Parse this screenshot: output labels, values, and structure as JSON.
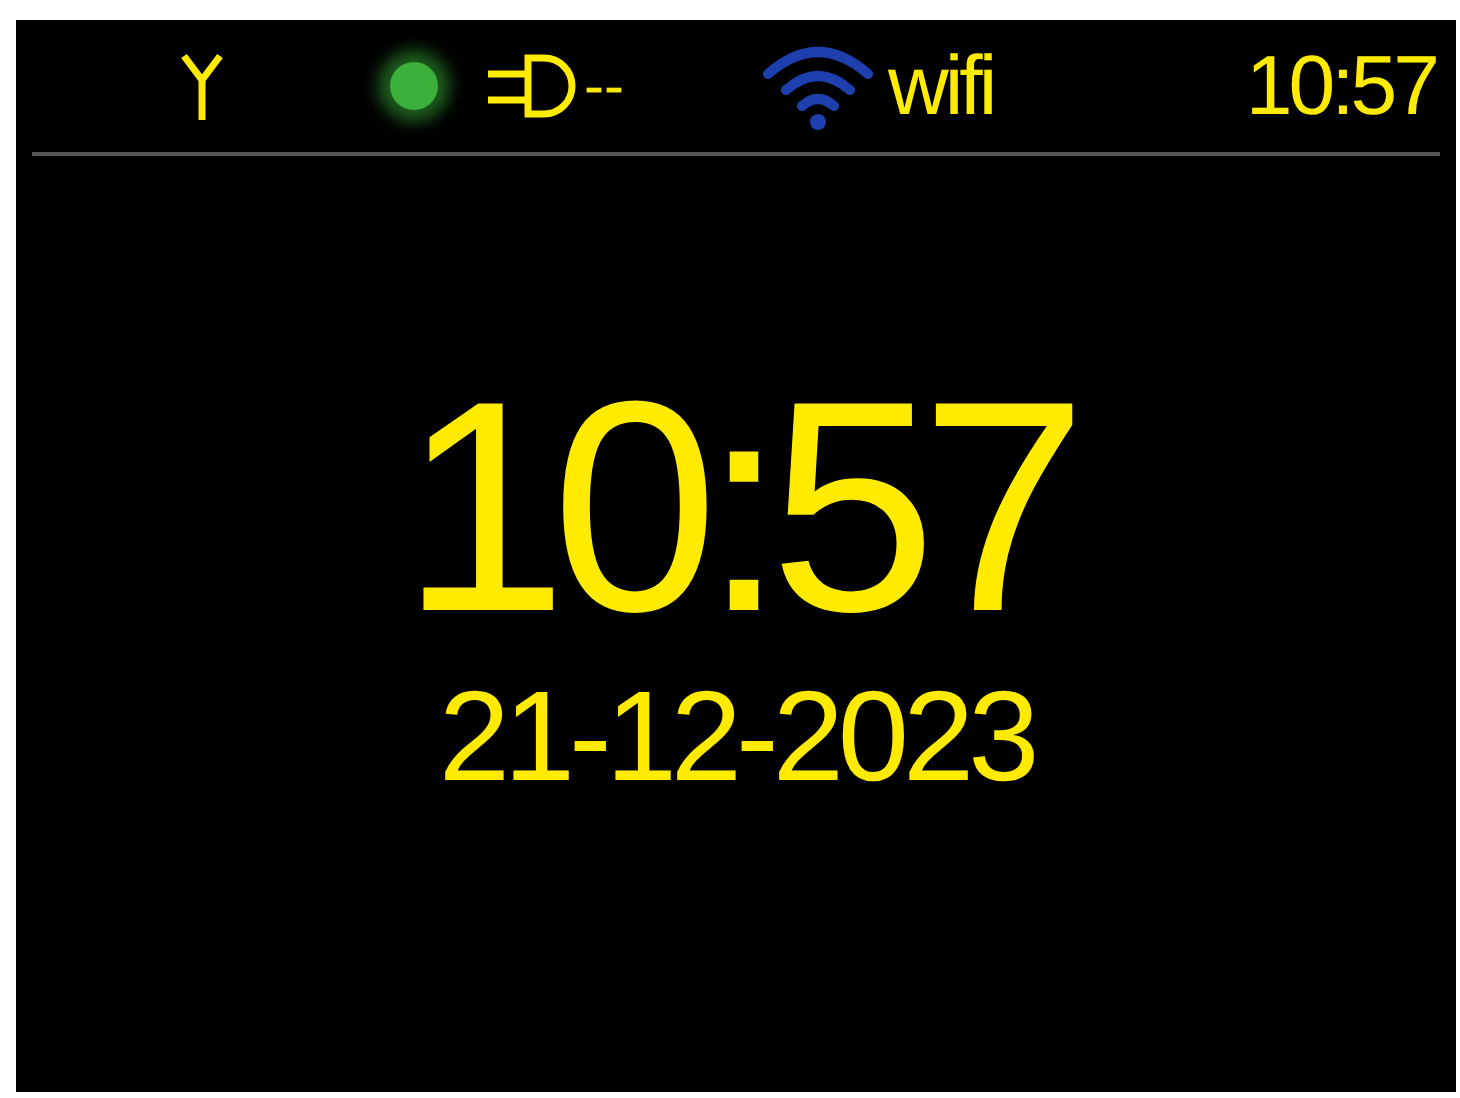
{
  "status_bar": {
    "led": {
      "color": "#3bb03b"
    },
    "power_reading": "--",
    "wifi_label": "wifi",
    "time": "10:57"
  },
  "clock": {
    "time": "10:57",
    "date": "21-12-2023"
  }
}
